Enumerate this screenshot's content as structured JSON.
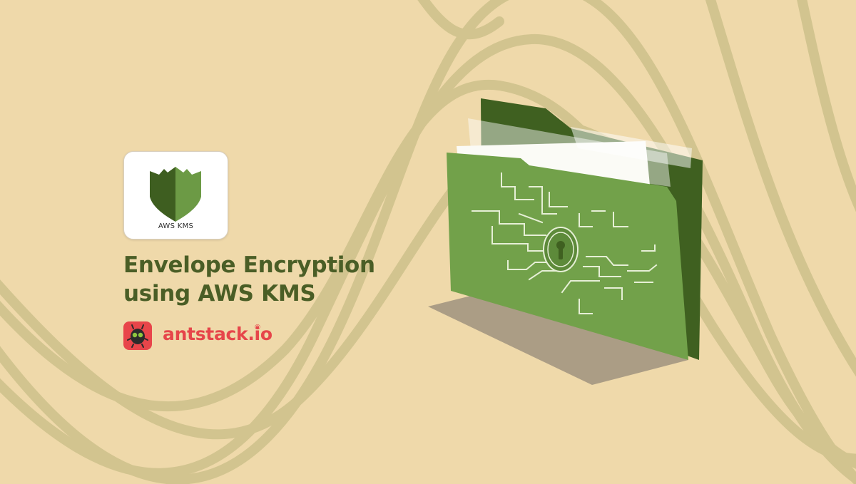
{
  "badge": {
    "label": "AWS KMS"
  },
  "title": {
    "line1": "Envelope Encryption",
    "line2": "using AWS KMS"
  },
  "brand": {
    "name": "antstack.io",
    "registered": "®"
  },
  "icons": {
    "kms": "aws-kms-shield-icon",
    "brand": "antstack-ant-icon",
    "folder": "locked-folder-icon",
    "keyhole": "keyhole-icon"
  },
  "colors": {
    "background": "#efd9aa",
    "waves": "#d2c48f",
    "title": "#4a5e26",
    "brand": "#e6454a",
    "folder_front": "#72a14a",
    "folder_back": "#3f6020",
    "shadow": "#ab9d85"
  }
}
